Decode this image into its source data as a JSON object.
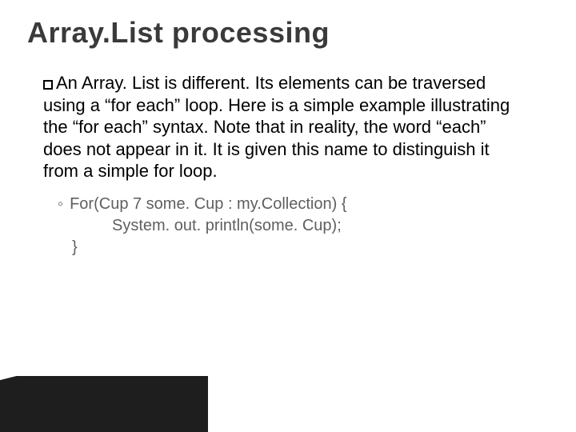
{
  "title": "Array.List processing",
  "bullet": {
    "lead": "An",
    "rest": " Array. List is different.  Its elements can be traversed using a “for each” loop.  Here is a simple example illustrating the “for each” syntax.  Note that in reality, the word “each” does not appear in it.  It is given this name to distinguish it from a simple for loop."
  },
  "code": {
    "marker": "◦",
    "line1": "For(Cup 7 some. Cup : my.Collection) {",
    "line2": "System. out. println(some. Cup);",
    "line3": "}"
  }
}
